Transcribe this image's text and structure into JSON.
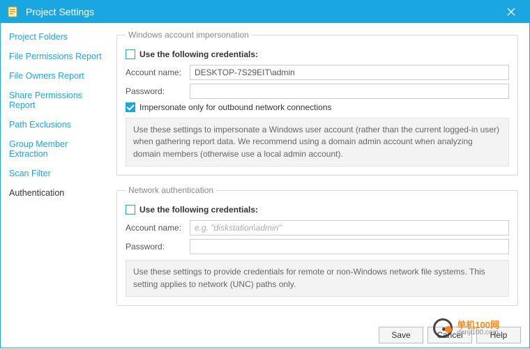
{
  "window": {
    "title": "Project Settings"
  },
  "sidebar": {
    "items": [
      {
        "label": "Project Folders"
      },
      {
        "label": "File Permissions Report"
      },
      {
        "label": "File Owners Report"
      },
      {
        "label": "Share Permissions Report"
      },
      {
        "label": "Path Exclusions"
      },
      {
        "label": "Group Member Extraction"
      },
      {
        "label": "Scan Filter"
      },
      {
        "label": "Authentication"
      }
    ],
    "selected_index": 7
  },
  "impersonation": {
    "legend": "Windows account impersonation",
    "use_creds_label": "Use the following credentials:",
    "use_creds_checked": false,
    "account_label": "Account name:",
    "account_value": "DESKTOP-7S29EIT\\admin",
    "password_label": "Password:",
    "password_value": "",
    "outbound_only_label": "Impersonate only for outbound network connections",
    "outbound_only_checked": true,
    "info": "Use these settings to impersonate a Windows user account (rather than the current logged-in user) when gathering report data. We recommend using a domain admin account when analyzing domain members (otherwise use a local admin account)."
  },
  "network_auth": {
    "legend": "Network authentication",
    "use_creds_label": "Use the following credentials:",
    "use_creds_checked": false,
    "account_label": "Account name:",
    "account_placeholder": "e.g. \"diskstation\\admin\"",
    "account_value": "",
    "password_label": "Password:",
    "password_value": "",
    "info": "Use these settings to provide credentials for remote or non-Windows network file systems. This setting applies to network (UNC) paths only."
  },
  "footer": {
    "save": "Save",
    "cancel": "Cancel",
    "help": "Help"
  },
  "watermark": {
    "top": "单机100网",
    "bot": "danji100.com"
  }
}
